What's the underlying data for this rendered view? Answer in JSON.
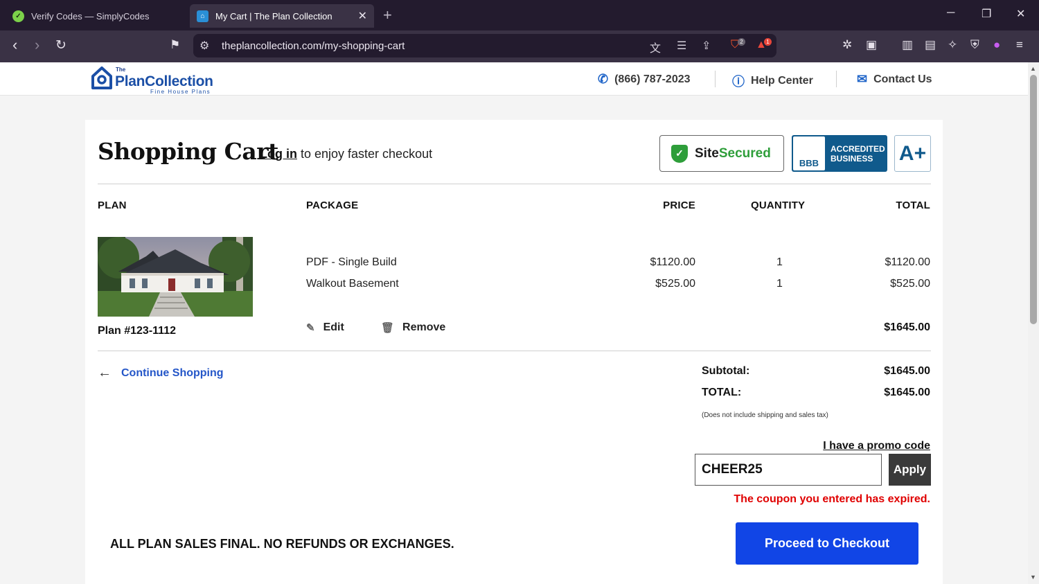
{
  "browser": {
    "tabs": [
      {
        "title": "Verify Codes — SimplyCodes",
        "active": false
      },
      {
        "title": "My Cart | The Plan Collection",
        "active": true
      }
    ],
    "url": "theplancollection.com/my-shopping-cart",
    "brave_badge": "2",
    "alert_badge": "1"
  },
  "header": {
    "logo": {
      "the": "The",
      "name": "PlanCollection",
      "tagline": "Fine House Plans"
    },
    "phone": "(866) 787-2023",
    "help": "Help Center",
    "contact": "Contact Us"
  },
  "cart": {
    "title": "Shopping Cart",
    "login_link": "Log in",
    "login_text": "to enjoy faster checkout",
    "seals": {
      "site_secured_a": "Site",
      "site_secured_b": "Secured",
      "bbb_mark": "BBB",
      "bbb_line1": "ACCREDITED",
      "bbb_line2": "BUSINESS",
      "rating": "A+"
    },
    "columns": {
      "plan": "PLAN",
      "package": "PACKAGE",
      "price": "PRICE",
      "quantity": "QUANTITY",
      "total": "TOTAL"
    },
    "plan_number": "Plan #123-1112",
    "items": [
      {
        "package": "PDF - Single Build",
        "price": "$1120.00",
        "quantity": "1",
        "total": "$1120.00"
      },
      {
        "package": "Walkout Basement",
        "price": "$525.00",
        "quantity": "1",
        "total": "$525.00"
      }
    ],
    "edit_label": "Edit",
    "remove_label": "Remove",
    "line_total": "$1645.00",
    "continue_label": "Continue Shopping",
    "subtotal_label": "Subtotal:",
    "subtotal_value": "$1645.00",
    "total_label": "TOTAL:",
    "total_value": "$1645.00",
    "tax_note": "(Does not include shipping and sales tax)",
    "promo_link": "I have a promo code",
    "promo_value": "CHEER25",
    "apply_label": "Apply",
    "promo_error": "The coupon you entered has expired.",
    "policy": "ALL PLAN SALES FINAL. NO REFUNDS OR EXCHANGES.",
    "checkout_label": "Proceed to Checkout"
  },
  "colors": {
    "accent": "#1145e6",
    "link": "#2456c8",
    "error": "#e00000",
    "bbb": "#105a8c",
    "secure": "#2e9e3a"
  }
}
